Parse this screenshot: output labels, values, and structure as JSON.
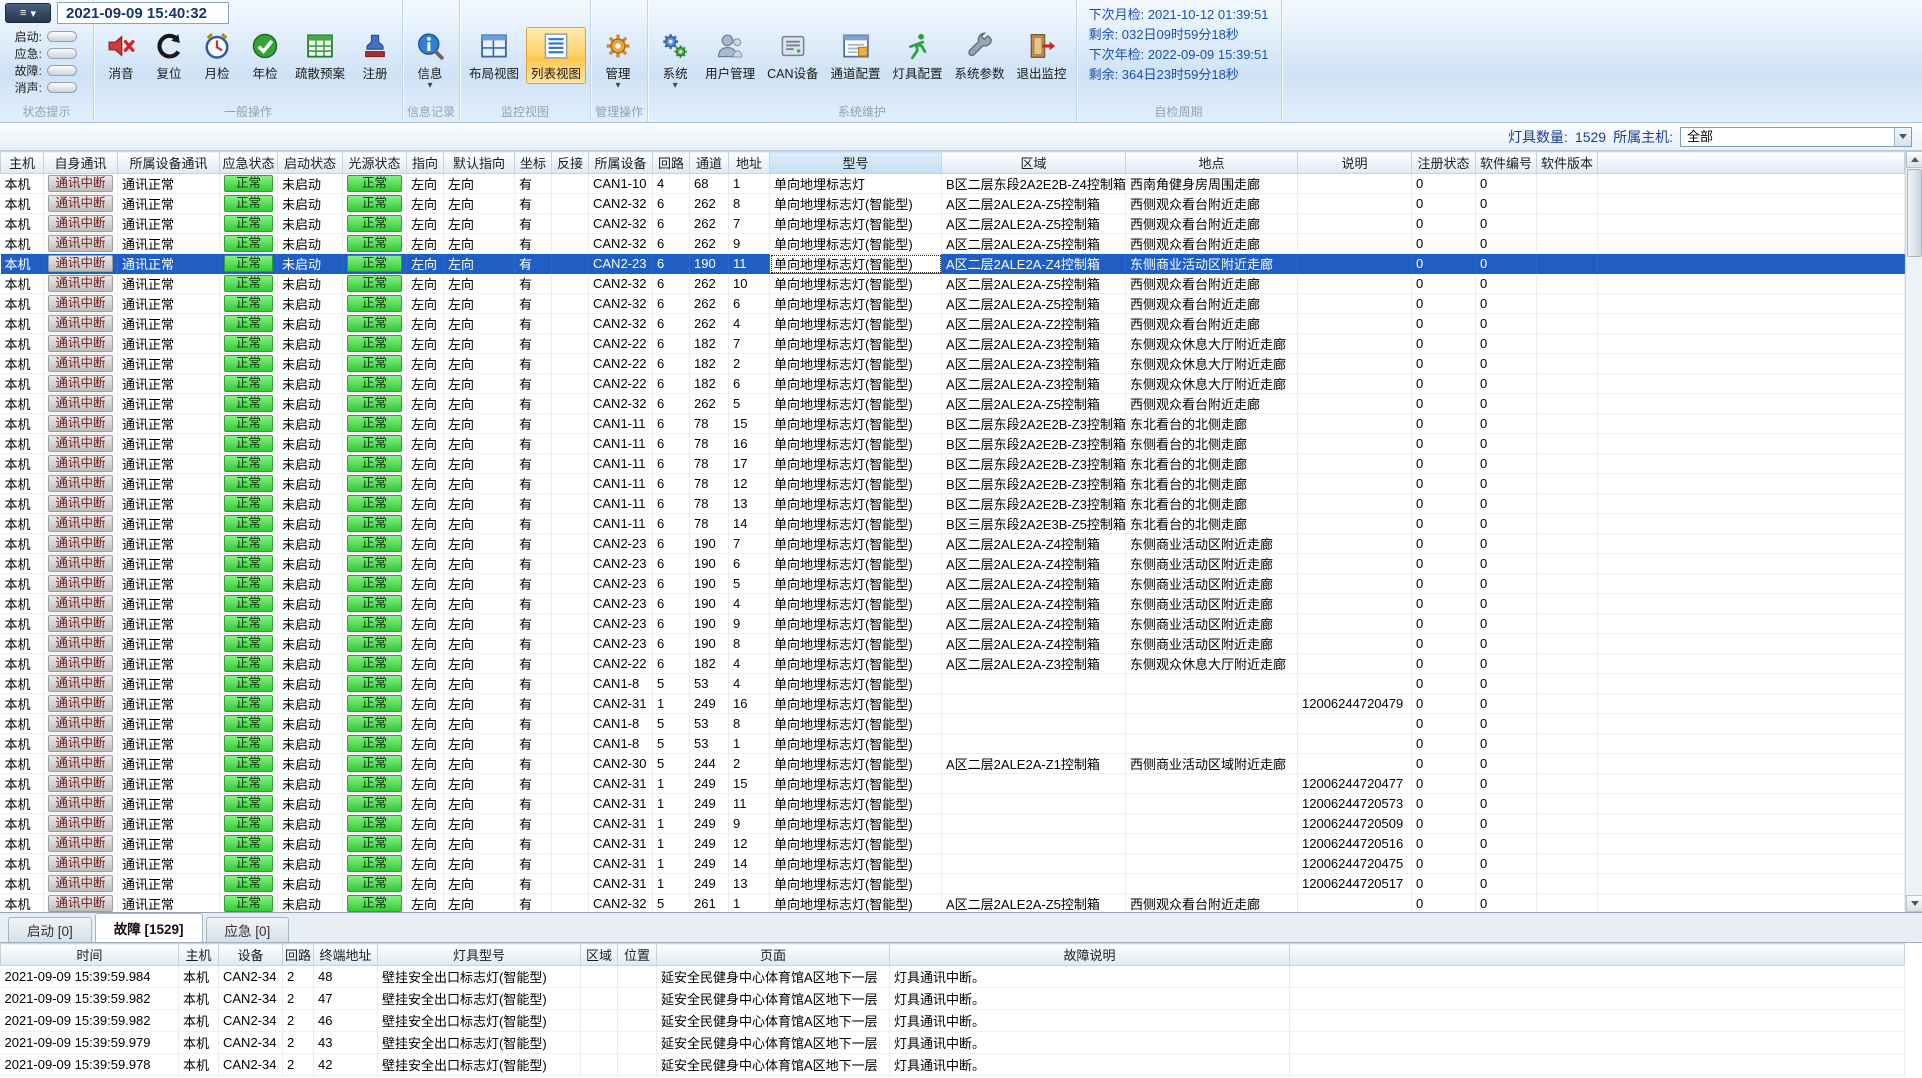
{
  "titlebar": {
    "timestamp": "2021-09-09 15:40:32"
  },
  "status_panel": {
    "items": [
      {
        "label": "启动:",
        "name": "status-start"
      },
      {
        "label": "应急:",
        "name": "status-emergency"
      },
      {
        "label": "故障:",
        "name": "status-fault"
      },
      {
        "label": "消声:",
        "name": "status-mute"
      }
    ]
  },
  "ribbon": {
    "groups": [
      {
        "label": "状态提示",
        "type": "status",
        "name": "status-hint"
      },
      {
        "label": "一般操作",
        "name": "general-ops",
        "buttons": [
          {
            "label": "消音",
            "icon": "mute-icon",
            "name": "mute-button"
          },
          {
            "label": "复位",
            "icon": "reset-icon",
            "name": "reset-button"
          },
          {
            "label": "月检",
            "icon": "monthly-check-icon",
            "name": "monthly-check-button"
          },
          {
            "label": "年检",
            "icon": "annual-check-icon",
            "name": "annual-check-button"
          },
          {
            "label": "疏散预案",
            "icon": "evacuation-plan-icon",
            "name": "evacuation-plan-button"
          },
          {
            "label": "注册",
            "icon": "register-icon",
            "name": "register-button"
          }
        ]
      },
      {
        "label": "信息记录",
        "name": "info-log",
        "buttons": [
          {
            "label": "信息",
            "icon": "info-icon",
            "name": "info-button",
            "dropdown": true
          }
        ]
      },
      {
        "label": "监控视图",
        "name": "monitor-view",
        "buttons": [
          {
            "label": "布局视图",
            "icon": "layout-view-icon",
            "name": "layout-view-button"
          },
          {
            "label": "列表视图",
            "icon": "list-view-icon",
            "name": "list-view-button",
            "selected": true
          }
        ]
      },
      {
        "label": "管理操作",
        "name": "manage-ops",
        "buttons": [
          {
            "label": "管理",
            "icon": "manage-icon",
            "name": "manage-button",
            "dropdown": true
          }
        ]
      },
      {
        "label": "系统维护",
        "name": "system-maintenance",
        "buttons": [
          {
            "label": "系统",
            "icon": "system-icon",
            "name": "system-button",
            "dropdown": true
          },
          {
            "label": "用户管理",
            "icon": "user-management-icon",
            "name": "user-management-button"
          },
          {
            "label": "CAN设备",
            "icon": "can-device-icon",
            "name": "can-device-button"
          },
          {
            "label": "通道配置",
            "icon": "channel-config-icon",
            "name": "channel-config-button"
          },
          {
            "label": "灯具配置",
            "icon": "lamp-config-icon",
            "name": "lamp-config-button"
          },
          {
            "label": "系统参数",
            "icon": "system-params-icon",
            "name": "system-params-button"
          },
          {
            "label": "退出监控",
            "icon": "exit-monitor-icon",
            "name": "exit-monitor-button"
          }
        ]
      },
      {
        "label": "自检周期",
        "type": "selftest",
        "name": "selftest-cycle"
      }
    ],
    "selftest_lines": [
      "下次月检: 2021-10-12 01:39:51",
      "剩余: 032日09时59分18秒",
      "下次年检: 2022-09-09 15:39:51",
      "剩余: 364日23时59分18秒"
    ]
  },
  "filter_bar": {
    "count_label": "灯具数量:",
    "count_value": "1529",
    "host_label": "所属主机:",
    "host_value": "全部"
  },
  "main_table": {
    "columns": [
      "主机",
      "自身通讯",
      "所属设备通讯",
      "应急状态",
      "启动状态",
      "光源状态",
      "指向",
      "默认指向",
      "坐标",
      "反接",
      "所属设备",
      "回路",
      "通道",
      "地址",
      "型号",
      "区域",
      "地点",
      "说明",
      "注册状态",
      "软件编号",
      "软件版本"
    ],
    "selected_row_index": 4,
    "rows": [
      [
        "本机",
        "通讯中断",
        "通讯正常",
        "正常",
        "未启动",
        "正常",
        "左向",
        "左向",
        "有",
        "",
        "CAN1-10",
        "4",
        "68",
        "1",
        "单向地埋标志灯",
        "B区二层东段2A2E2B-Z4控制箱",
        "西南角健身房周围走廊",
        "",
        "0",
        "0",
        ""
      ],
      [
        "本机",
        "通讯中断",
        "通讯正常",
        "正常",
        "未启动",
        "正常",
        "左向",
        "左向",
        "有",
        "",
        "CAN2-32",
        "6",
        "262",
        "8",
        "单向地埋标志灯(智能型)",
        "A区二层2ALE2A-Z5控制箱",
        "西侧观众看台附近走廊",
        "",
        "0",
        "0",
        ""
      ],
      [
        "本机",
        "通讯中断",
        "通讯正常",
        "正常",
        "未启动",
        "正常",
        "左向",
        "左向",
        "有",
        "",
        "CAN2-32",
        "6",
        "262",
        "7",
        "单向地埋标志灯(智能型)",
        "A区二层2ALE2A-Z5控制箱",
        "西侧观众看台附近走廊",
        "",
        "0",
        "0",
        ""
      ],
      [
        "本机",
        "通讯中断",
        "通讯正常",
        "正常",
        "未启动",
        "正常",
        "左向",
        "左向",
        "有",
        "",
        "CAN2-32",
        "6",
        "262",
        "9",
        "单向地埋标志灯(智能型)",
        "A区二层2ALE2A-Z5控制箱",
        "西侧观众看台附近走廊",
        "",
        "0",
        "0",
        ""
      ],
      [
        "本机",
        "通讯中断",
        "通讯正常",
        "正常",
        "未启动",
        "正常",
        "左向",
        "左向",
        "有",
        "",
        "CAN2-23",
        "6",
        "190",
        "11",
        "单向地埋标志灯(智能型)",
        "A区二层2ALE2A-Z4控制箱",
        "东侧商业活动区附近走廊",
        "",
        "0",
        "0",
        ""
      ],
      [
        "本机",
        "通讯中断",
        "通讯正常",
        "正常",
        "未启动",
        "正常",
        "左向",
        "左向",
        "有",
        "",
        "CAN2-32",
        "6",
        "262",
        "10",
        "单向地埋标志灯(智能型)",
        "A区二层2ALE2A-Z5控制箱",
        "西侧观众看台附近走廊",
        "",
        "0",
        "0",
        ""
      ],
      [
        "本机",
        "通讯中断",
        "通讯正常",
        "正常",
        "未启动",
        "正常",
        "左向",
        "左向",
        "有",
        "",
        "CAN2-32",
        "6",
        "262",
        "6",
        "单向地埋标志灯(智能型)",
        "A区二层2ALE2A-Z5控制箱",
        "西侧观众看台附近走廊",
        "",
        "0",
        "0",
        ""
      ],
      [
        "本机",
        "通讯中断",
        "通讯正常",
        "正常",
        "未启动",
        "正常",
        "左向",
        "左向",
        "有",
        "",
        "CAN2-32",
        "6",
        "262",
        "4",
        "单向地埋标志灯(智能型)",
        "A区二层2ALE2A-Z2控制箱",
        "西侧观众看台附近走廊",
        "",
        "0",
        "0",
        ""
      ],
      [
        "本机",
        "通讯中断",
        "通讯正常",
        "正常",
        "未启动",
        "正常",
        "左向",
        "左向",
        "有",
        "",
        "CAN2-22",
        "6",
        "182",
        "7",
        "单向地埋标志灯(智能型)",
        "A区二层2ALE2A-Z3控制箱",
        "东侧观众休息大厅附近走廊",
        "",
        "0",
        "0",
        ""
      ],
      [
        "本机",
        "通讯中断",
        "通讯正常",
        "正常",
        "未启动",
        "正常",
        "左向",
        "左向",
        "有",
        "",
        "CAN2-22",
        "6",
        "182",
        "2",
        "单向地埋标志灯(智能型)",
        "A区二层2ALE2A-Z3控制箱",
        "东侧观众休息大厅附近走廊",
        "",
        "0",
        "0",
        ""
      ],
      [
        "本机",
        "通讯中断",
        "通讯正常",
        "正常",
        "未启动",
        "正常",
        "左向",
        "左向",
        "有",
        "",
        "CAN2-22",
        "6",
        "182",
        "6",
        "单向地埋标志灯(智能型)",
        "A区二层2ALE2A-Z3控制箱",
        "东侧观众休息大厅附近走廊",
        "",
        "0",
        "0",
        ""
      ],
      [
        "本机",
        "通讯中断",
        "通讯正常",
        "正常",
        "未启动",
        "正常",
        "左向",
        "左向",
        "有",
        "",
        "CAN2-32",
        "6",
        "262",
        "5",
        "单向地埋标志灯(智能型)",
        "A区二层2ALE2A-Z5控制箱",
        "西侧观众看台附近走廊",
        "",
        "0",
        "0",
        ""
      ],
      [
        "本机",
        "通讯中断",
        "通讯正常",
        "正常",
        "未启动",
        "正常",
        "左向",
        "左向",
        "有",
        "",
        "CAN1-11",
        "6",
        "78",
        "15",
        "单向地埋标志灯(智能型)",
        "B区二层东段2A2E2B-Z3控制箱",
        "东北看台的北侧走廊",
        "",
        "0",
        "0",
        ""
      ],
      [
        "本机",
        "通讯中断",
        "通讯正常",
        "正常",
        "未启动",
        "正常",
        "左向",
        "左向",
        "有",
        "",
        "CAN1-11",
        "6",
        "78",
        "16",
        "单向地埋标志灯(智能型)",
        "B区二层东段2A2E2B-Z3控制箱",
        "东侧看台的北侧走廊",
        "",
        "0",
        "0",
        ""
      ],
      [
        "本机",
        "通讯中断",
        "通讯正常",
        "正常",
        "未启动",
        "正常",
        "左向",
        "左向",
        "有",
        "",
        "CAN1-11",
        "6",
        "78",
        "17",
        "单向地埋标志灯(智能型)",
        "B区二层东段2A2E2B-Z3控制箱",
        "东北看台的北侧走廊",
        "",
        "0",
        "0",
        ""
      ],
      [
        "本机",
        "通讯中断",
        "通讯正常",
        "正常",
        "未启动",
        "正常",
        "左向",
        "左向",
        "有",
        "",
        "CAN1-11",
        "6",
        "78",
        "12",
        "单向地埋标志灯(智能型)",
        "B区二层东段2A2E2B-Z3控制箱",
        "东北看台的北侧走廊",
        "",
        "0",
        "0",
        ""
      ],
      [
        "本机",
        "通讯中断",
        "通讯正常",
        "正常",
        "未启动",
        "正常",
        "左向",
        "左向",
        "有",
        "",
        "CAN1-11",
        "6",
        "78",
        "13",
        "单向地埋标志灯(智能型)",
        "B区二层东段2A2E2B-Z3控制箱",
        "东北看台的北侧走廊",
        "",
        "0",
        "0",
        ""
      ],
      [
        "本机",
        "通讯中断",
        "通讯正常",
        "正常",
        "未启动",
        "正常",
        "左向",
        "左向",
        "有",
        "",
        "CAN1-11",
        "6",
        "78",
        "14",
        "单向地埋标志灯(智能型)",
        "B区三层东段2A2E3B-Z5控制箱",
        "东北看台的北侧走廊",
        "",
        "0",
        "0",
        ""
      ],
      [
        "本机",
        "通讯中断",
        "通讯正常",
        "正常",
        "未启动",
        "正常",
        "左向",
        "左向",
        "有",
        "",
        "CAN2-23",
        "6",
        "190",
        "7",
        "单向地埋标志灯(智能型)",
        "A区二层2ALE2A-Z4控制箱",
        "东侧商业活动区附近走廊",
        "",
        "0",
        "0",
        ""
      ],
      [
        "本机",
        "通讯中断",
        "通讯正常",
        "正常",
        "未启动",
        "正常",
        "左向",
        "左向",
        "有",
        "",
        "CAN2-23",
        "6",
        "190",
        "6",
        "单向地埋标志灯(智能型)",
        "A区二层2ALE2A-Z4控制箱",
        "东侧商业活动区附近走廊",
        "",
        "0",
        "0",
        ""
      ],
      [
        "本机",
        "通讯中断",
        "通讯正常",
        "正常",
        "未启动",
        "正常",
        "左向",
        "左向",
        "有",
        "",
        "CAN2-23",
        "6",
        "190",
        "5",
        "单向地埋标志灯(智能型)",
        "A区二层2ALE2A-Z4控制箱",
        "东侧商业活动区附近走廊",
        "",
        "0",
        "0",
        ""
      ],
      [
        "本机",
        "通讯中断",
        "通讯正常",
        "正常",
        "未启动",
        "正常",
        "左向",
        "左向",
        "有",
        "",
        "CAN2-23",
        "6",
        "190",
        "4",
        "单向地埋标志灯(智能型)",
        "A区二层2ALE2A-Z4控制箱",
        "东侧商业活动区附近走廊",
        "",
        "0",
        "0",
        ""
      ],
      [
        "本机",
        "通讯中断",
        "通讯正常",
        "正常",
        "未启动",
        "正常",
        "左向",
        "左向",
        "有",
        "",
        "CAN2-23",
        "6",
        "190",
        "9",
        "单向地埋标志灯(智能型)",
        "A区二层2ALE2A-Z4控制箱",
        "东侧商业活动区附近走廊",
        "",
        "0",
        "0",
        ""
      ],
      [
        "本机",
        "通讯中断",
        "通讯正常",
        "正常",
        "未启动",
        "正常",
        "左向",
        "左向",
        "有",
        "",
        "CAN2-23",
        "6",
        "190",
        "8",
        "单向地埋标志灯(智能型)",
        "A区二层2ALE2A-Z4控制箱",
        "东侧商业活动区附近走廊",
        "",
        "0",
        "0",
        ""
      ],
      [
        "本机",
        "通讯中断",
        "通讯正常",
        "正常",
        "未启动",
        "正常",
        "左向",
        "左向",
        "有",
        "",
        "CAN2-22",
        "6",
        "182",
        "4",
        "单向地埋标志灯(智能型)",
        "A区二层2ALE2A-Z3控制箱",
        "东侧观众休息大厅附近走廊",
        "",
        "0",
        "0",
        ""
      ],
      [
        "本机",
        "通讯中断",
        "通讯正常",
        "正常",
        "未启动",
        "正常",
        "左向",
        "左向",
        "有",
        "",
        "CAN1-8",
        "5",
        "53",
        "4",
        "单向地埋标志灯(智能型)",
        "",
        "",
        "",
        "0",
        "0",
        ""
      ],
      [
        "本机",
        "通讯中断",
        "通讯正常",
        "正常",
        "未启动",
        "正常",
        "左向",
        "左向",
        "有",
        "",
        "CAN2-31",
        "1",
        "249",
        "16",
        "单向地埋标志灯(智能型)",
        "",
        "",
        "12006244720479",
        "0",
        "0",
        ""
      ],
      [
        "本机",
        "通讯中断",
        "通讯正常",
        "正常",
        "未启动",
        "正常",
        "左向",
        "左向",
        "有",
        "",
        "CAN1-8",
        "5",
        "53",
        "8",
        "单向地埋标志灯(智能型)",
        "",
        "",
        "",
        "0",
        "0",
        ""
      ],
      [
        "本机",
        "通讯中断",
        "通讯正常",
        "正常",
        "未启动",
        "正常",
        "左向",
        "左向",
        "有",
        "",
        "CAN1-8",
        "5",
        "53",
        "1",
        "单向地埋标志灯(智能型)",
        "",
        "",
        "",
        "0",
        "0",
        ""
      ],
      [
        "本机",
        "通讯中断",
        "通讯正常",
        "正常",
        "未启动",
        "正常",
        "左向",
        "左向",
        "有",
        "",
        "CAN2-30",
        "5",
        "244",
        "2",
        "单向地埋标志灯(智能型)",
        "A区二层2ALE2A-Z1控制箱",
        "西侧商业活动区域附近走廊",
        "",
        "0",
        "0",
        ""
      ],
      [
        "本机",
        "通讯中断",
        "通讯正常",
        "正常",
        "未启动",
        "正常",
        "左向",
        "左向",
        "有",
        "",
        "CAN2-31",
        "1",
        "249",
        "15",
        "单向地埋标志灯(智能型)",
        "",
        "",
        "12006244720477",
        "0",
        "0",
        ""
      ],
      [
        "本机",
        "通讯中断",
        "通讯正常",
        "正常",
        "未启动",
        "正常",
        "左向",
        "左向",
        "有",
        "",
        "CAN2-31",
        "1",
        "249",
        "11",
        "单向地埋标志灯(智能型)",
        "",
        "",
        "12006244720573",
        "0",
        "0",
        ""
      ],
      [
        "本机",
        "通讯中断",
        "通讯正常",
        "正常",
        "未启动",
        "正常",
        "左向",
        "左向",
        "有",
        "",
        "CAN2-31",
        "1",
        "249",
        "9",
        "单向地埋标志灯(智能型)",
        "",
        "",
        "12006244720509",
        "0",
        "0",
        ""
      ],
      [
        "本机",
        "通讯中断",
        "通讯正常",
        "正常",
        "未启动",
        "正常",
        "左向",
        "左向",
        "有",
        "",
        "CAN2-31",
        "1",
        "249",
        "12",
        "单向地埋标志灯(智能型)",
        "",
        "",
        "12006244720516",
        "0",
        "0",
        ""
      ],
      [
        "本机",
        "通讯中断",
        "通讯正常",
        "正常",
        "未启动",
        "正常",
        "左向",
        "左向",
        "有",
        "",
        "CAN2-31",
        "1",
        "249",
        "14",
        "单向地埋标志灯(智能型)",
        "",
        "",
        "12006244720475",
        "0",
        "0",
        ""
      ],
      [
        "本机",
        "通讯中断",
        "通讯正常",
        "正常",
        "未启动",
        "正常",
        "左向",
        "左向",
        "有",
        "",
        "CAN2-31",
        "1",
        "249",
        "13",
        "单向地埋标志灯(智能型)",
        "",
        "",
        "12006244720517",
        "0",
        "0",
        ""
      ],
      [
        "本机",
        "通讯中断",
        "通讯正常",
        "正常",
        "未启动",
        "正常",
        "左向",
        "左向",
        "有",
        "",
        "CAN2-32",
        "5",
        "261",
        "1",
        "单向地埋标志灯(智能型)",
        "A区二层2ALE2A-Z5控制箱",
        "西侧观众看台附近走廊",
        "",
        "0",
        "0",
        ""
      ]
    ]
  },
  "bottom_tabs": [
    {
      "label": "启动 [0]",
      "name": "tab-start"
    },
    {
      "label": "故障 [1529]",
      "name": "tab-fault",
      "active": true
    },
    {
      "label": "应急 [0]",
      "name": "tab-emergency"
    }
  ],
  "fault_table": {
    "columns": [
      "时间",
      "主机",
      "设备",
      "回路",
      "终端地址",
      "灯具型号",
      "区域",
      "位置",
      "页面",
      "故障说明"
    ],
    "rows": [
      [
        "2021-09-09 15:39:59.984",
        "本机",
        "CAN2-34",
        "2",
        "48",
        "壁挂安全出口标志灯(智能型)",
        "",
        "",
        "延安全民健身中心体育馆A区地下一层",
        "灯具通讯中断。"
      ],
      [
        "2021-09-09 15:39:59.982",
        "本机",
        "CAN2-34",
        "2",
        "47",
        "壁挂安全出口标志灯(智能型)",
        "",
        "",
        "延安全民健身中心体育馆A区地下一层",
        "灯具通讯中断。"
      ],
      [
        "2021-09-09 15:39:59.982",
        "本机",
        "CAN2-34",
        "2",
        "46",
        "壁挂安全出口标志灯(智能型)",
        "",
        "",
        "延安全民健身中心体育馆A区地下一层",
        "灯具通讯中断。"
      ],
      [
        "2021-09-09 15:39:59.979",
        "本机",
        "CAN2-34",
        "2",
        "43",
        "壁挂安全出口标志灯(智能型)",
        "",
        "",
        "延安全民健身中心体育馆A区地下一层",
        "灯具通讯中断。"
      ],
      [
        "2021-09-09 15:39:59.978",
        "本机",
        "CAN2-34",
        "2",
        "42",
        "壁挂安全出口标志灯(智能型)",
        "",
        "",
        "延安全民健身中心体育馆A区地下一层",
        "灯具通讯中断。"
      ]
    ]
  },
  "colors": {
    "accent_blue": "#1f5fc4",
    "status_green": "#33cc33",
    "status_gray": "#bcbcbc",
    "selected_button": "#fdc74e",
    "info_text_blue": "#1c4fb0"
  }
}
